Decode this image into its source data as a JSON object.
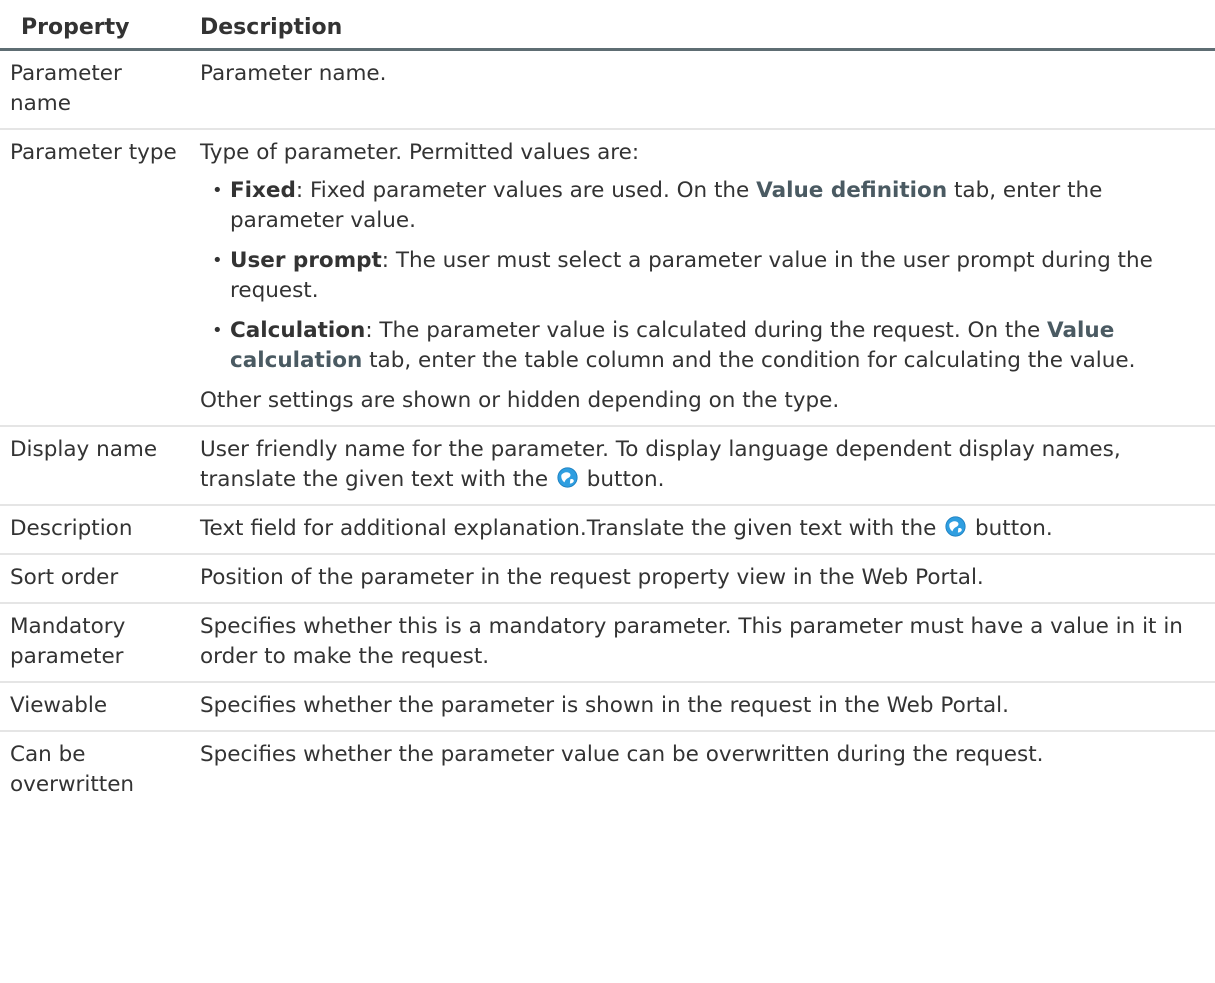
{
  "header": {
    "property": "Property",
    "description": "Description"
  },
  "rows": {
    "parameter_name": {
      "property": "Parameter name",
      "description": "Parameter name."
    },
    "parameter_type": {
      "property": "Parameter type",
      "intro": "Type of parameter. Permitted values are:",
      "items": [
        {
          "term": "Fixed",
          "text_1": ": Fixed parameter values are used. On the ",
          "ui_term": "Value definition",
          "text_2": " tab, enter the parameter value."
        },
        {
          "term": "User prompt",
          "text_1": ": The user must select a parameter value in the user prompt during the request."
        },
        {
          "term": "Calculation",
          "text_1": ": The parameter value is calculated during the request. On the ",
          "ui_term": "Value calculation",
          "text_2": " tab, enter the table column and the condition for calculating the value."
        }
      ],
      "footer": "Other settings are shown or hidden depending on the type."
    },
    "display_name": {
      "property": "Display name",
      "text_1": "User friendly name for the parameter. To display language dependent display names, translate the given text with the ",
      "icon": "translate-globe-icon",
      "text_2": " button."
    },
    "description": {
      "property": "Description",
      "text_1": "Text field for additional explanation.Translate the given text with the ",
      "icon": "translate-globe-icon",
      "text_2": " button."
    },
    "sort_order": {
      "property": "Sort order",
      "description": "Position of the parameter in the request property view in the Web Portal."
    },
    "mandatory_parameter": {
      "property": "Mandatory parameter",
      "description": "Specifies whether this is a mandatory parameter. This parameter must have a value in it in order to make the request."
    },
    "viewable": {
      "property": "Viewable",
      "description": "Specifies whether the parameter is shown in the request in the Web Portal."
    },
    "can_be_overwritten": {
      "property": "Can be overwritten",
      "description": "Specifies whether the parameter value can be overwritten during the request."
    }
  },
  "colors": {
    "text": "#333333",
    "ui_term": "#4a5a62",
    "header_rule": "#5e6d73",
    "row_rule": "#e5e5e5",
    "icon_blue": "#2f9ee0"
  }
}
